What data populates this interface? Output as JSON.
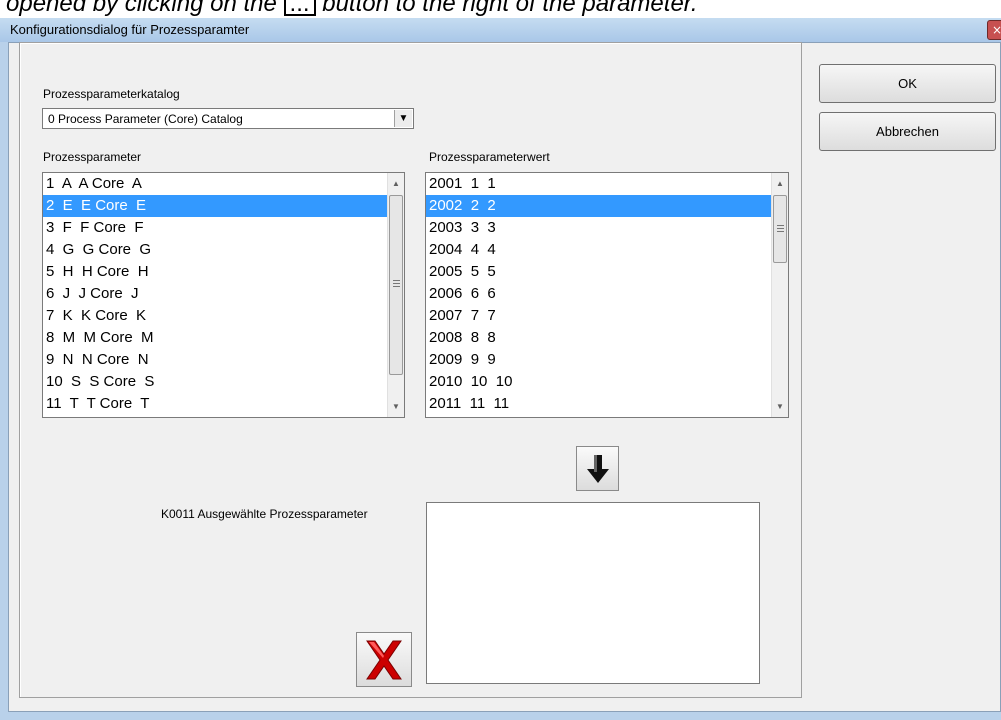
{
  "caption": {
    "prefix": "opened by clicking on the",
    "button_glyph": "...",
    "suffix": "button to the right of the parameter."
  },
  "window": {
    "title": "Konfigurationsdialog für Prozessparamter",
    "close_glyph": "×"
  },
  "catalog": {
    "label": "Prozessparameterkatalog",
    "selected": "0  Process Parameter (Core) Catalog",
    "dropdown_glyph": "▼"
  },
  "parameters": {
    "label": "Prozessparameter",
    "items": [
      "1  A  A Core  A",
      "2  E  E Core  E",
      "3  F  F Core  F",
      "4  G  G Core  G",
      "5  H  H Core  H",
      "6  J  J Core  J",
      "7  K  K Core  K",
      "8  M  M Core  M",
      "9  N  N Core  N",
      "10  S  S Core  S",
      "11  T  T Core  T"
    ],
    "selected_index": 1
  },
  "values": {
    "label": "Prozessparameterwert",
    "items": [
      "2001  1  1",
      "2002  2  2",
      "2003  3  3",
      "2004  4  4",
      "2005  5  5",
      "2006  6  6",
      "2007  7  7",
      "2008  8  8",
      "2009  9  9",
      "2010  10  10",
      "2011  11  11"
    ],
    "selected_index": 1
  },
  "selected_params": {
    "label": "K0011 Ausgewählte Prozessparameter",
    "value": ""
  },
  "buttons": {
    "ok": "OK",
    "cancel": "Abbrechen"
  },
  "icons": {
    "add": "arrow-down-icon",
    "delete": "red-x-icon"
  },
  "colors": {
    "selection": "#3399ff",
    "delete_icon": "#cc0000"
  }
}
